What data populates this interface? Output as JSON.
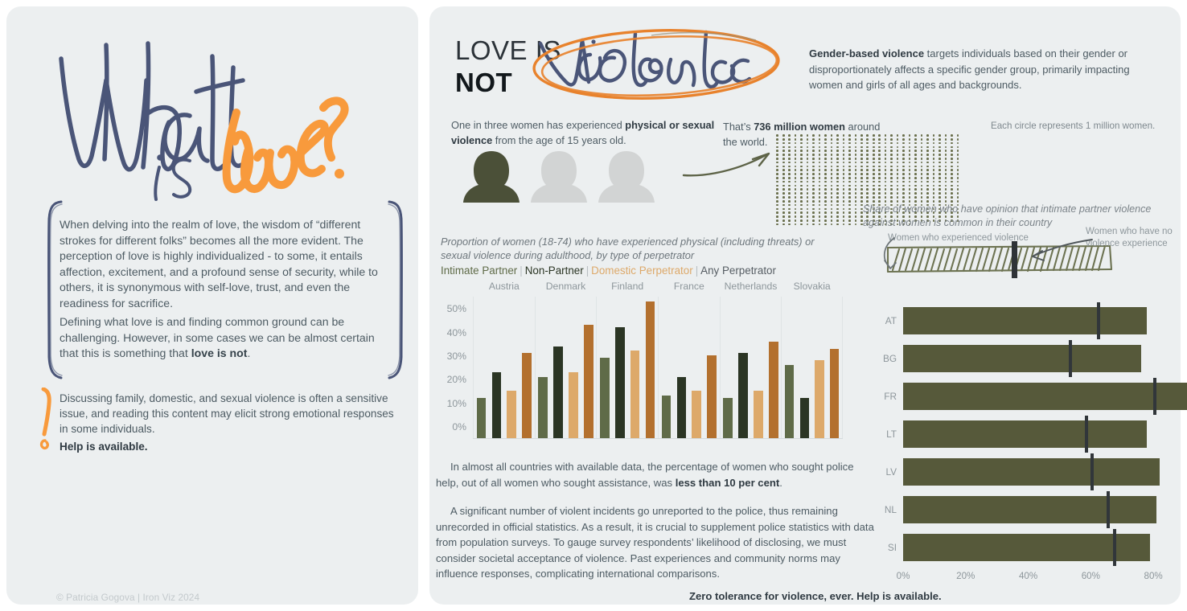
{
  "left": {
    "hand_title_part1": "What is",
    "hand_title_part2": "love?",
    "paragraph1": "When delving into the realm of love, the wisdom of “different strokes for different folks” becomes all the more evident. The perception of love is highly individualized - to some, it entails affection, excitement, and a profound sense of security, while to others, it is synonymous with self-love, trust, and even the readiness for sacrifice.",
    "paragraph2_pre": "Defining what love is and finding common ground can be challenging. However, in some cases we can be almost certain that this is something that ",
    "paragraph2_bold": "love is not",
    "paragraph2_post": ".",
    "warning_text": "Discussing family, domestic, and sexual violence is often a sensitive issue, and reading this content may elicit strong emotional responses in some individuals.",
    "warning_help": "Help is available.",
    "credit": "© Patricia Gogova | Iron Viz 2024"
  },
  "header": {
    "title_line1": "LOVE IS",
    "title_line2": "NOT",
    "title_script": "violence",
    "intro_bold": "Gender-based violence",
    "intro_rest": " targets individuals based on their gender or disproportionately affects a specific gender group, primarily impacting women and girls of all ages and backgrounds."
  },
  "stats": {
    "one_in_three_pre": "One in three women has experienced ",
    "one_in_three_bold1": "physical or sexual violence",
    "one_in_three_post": " from the age of 15 years old.",
    "thats_pre": "That’s ",
    "thats_bold": "736 million women",
    "thats_post": " around the world.",
    "dot_caption": "Each circle represents 1 million women.",
    "dot_count": 736,
    "dot_columns": 46,
    "figures_total": 3,
    "figures_highlighted": 1
  },
  "chart_data": [
    {
      "type": "bar",
      "title": "Proportion of women (18-74) who have experienced physical (including threats) or sexual violence during adulthood, by type of perpetrator",
      "legend": [
        "Intimate Partner",
        "Non-Partner",
        "Domestic Perpetrator",
        "Any Perpetrator"
      ],
      "legend_colors": [
        "#5f6b48",
        "#2b3524",
        "#dda96a",
        "#b3702e"
      ],
      "categories": [
        "Austria",
        "Denmark",
        "Finland",
        "France",
        "Netherlands",
        "Slovakia"
      ],
      "series": [
        {
          "name": "Intimate Partner",
          "values": [
            17,
            26,
            34,
            18,
            17,
            31
          ]
        },
        {
          "name": "Non-Partner",
          "values": [
            28,
            39,
            47,
            26,
            36,
            17
          ]
        },
        {
          "name": "Domestic Perpetrator",
          "values": [
            20,
            28,
            37,
            20,
            20,
            33
          ]
        },
        {
          "name": "Any Perpetrator",
          "values": [
            36,
            48,
            58,
            35,
            41,
            38
          ]
        }
      ],
      "ylabel": "",
      "xlabel": "",
      "ylim": [
        0,
        60
      ],
      "yticks": [
        "0%",
        "10%",
        "20%",
        "30%",
        "40%",
        "50%"
      ],
      "ytick_values": [
        0,
        10,
        20,
        30,
        40,
        50
      ],
      "grid": false
    },
    {
      "type": "bar",
      "orientation": "horizontal",
      "title": "Share of women who have opinion that intimate partner violence against women is common in their country",
      "legend_experienced": "Women who experienced violence",
      "legend_no_experience": "Women who have no violence experience",
      "categories": [
        "AT",
        "BG",
        "FR",
        "LT",
        "LV",
        "NL",
        "SI"
      ],
      "values": [
        78,
        76,
        93,
        78,
        82,
        81,
        79
      ],
      "marker_name": "Women who experienced violence",
      "marker_values": [
        62,
        53,
        80,
        58,
        60,
        65,
        67
      ],
      "bar_color": "#56593a",
      "marker_color": "#31363a",
      "xlim": [
        0,
        90
      ],
      "xticks": [
        "0%",
        "20%",
        "40%",
        "60%",
        "80%"
      ],
      "xtick_values": [
        0,
        20,
        40,
        60,
        80
      ],
      "grid": false
    }
  ],
  "body": {
    "police_pre": "In almost all countries with available data, the percentage of women who sought police help, out of all women who sought assistance, was ",
    "police_bold": "less than 10 per cent",
    "police_post": ".",
    "unreported": "A significant number of violent incidents go unreported to the police, thus remaining unrecorded in official statistics. As a result, it is crucial to supplement police statistics with data from population surveys. To gauge survey respondents’ likelihood of disclosing, we must consider societal acceptance of violence. Past experiences and community norms may influence responses, complicating international comparisons.",
    "zero_tolerance": "Zero tolerance for violence, ever. Help is available."
  },
  "colors": {
    "panel_bg": "#eceff0",
    "orange": "#f0922e",
    "navy": "#4a5578",
    "olive_dark": "#2b3524",
    "olive": "#5f6b48",
    "tan": "#dda96a",
    "rust": "#b3702e"
  }
}
